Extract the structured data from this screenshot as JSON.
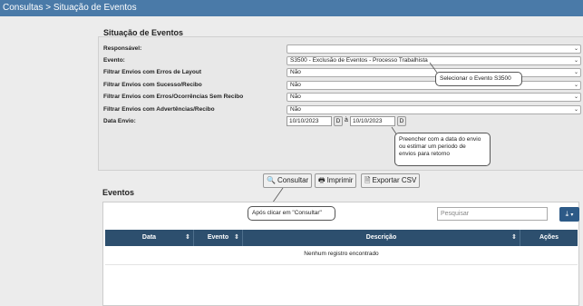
{
  "breadcrumb": "Consultas > Situação de Eventos",
  "situacao": {
    "legend": "Situação de Eventos",
    "fields": [
      {
        "label": "Responsável:",
        "value": ""
      },
      {
        "label": "Evento:",
        "value": "S3500 - Exclusão de Eventos - Processo Trabalhista"
      },
      {
        "label": "Filtrar Envios com Erros de Layout",
        "value": "Não"
      },
      {
        "label": "Filtrar Envios com Sucesso/Recibo",
        "value": "Não"
      },
      {
        "label": "Filtrar Envios com Erros/Ocorrências Sem Recibo",
        "value": "Não"
      },
      {
        "label": "Filtrar Envios com Advertências/Recibo",
        "value": "Não"
      }
    ],
    "data_envio": {
      "label": "Data Envio:",
      "from": "10/10/2023",
      "to": "10/10/2023",
      "btn": "D",
      "sep": "à"
    }
  },
  "callouts": {
    "evento": "Selecionar o Evento S3500",
    "data": [
      "Preencher com a data do envio",
      "ou estimar um periodo de",
      "envios para retorno"
    ],
    "consultar": "Após clicar em \"Consultar\""
  },
  "buttons": {
    "consultar": "Consultar",
    "imprimir": "Imprimir",
    "exportar": "Exportar CSV"
  },
  "eventos": {
    "legend": "Eventos",
    "search_placeholder": "Pesquisar",
    "columns": [
      "Data",
      "Evento",
      "Descrição",
      "Ações"
    ],
    "empty": "Nenhum registro encontrado"
  },
  "icons": {
    "chevron": "chevron-down-icon",
    "search": "search-icon",
    "print": "print-icon",
    "file": "file-icon",
    "download": "download-icon"
  },
  "colors": {
    "titlebar": "#4a7aa8",
    "table_header": "#2d4f6e",
    "export_button": "#2d5a87"
  }
}
